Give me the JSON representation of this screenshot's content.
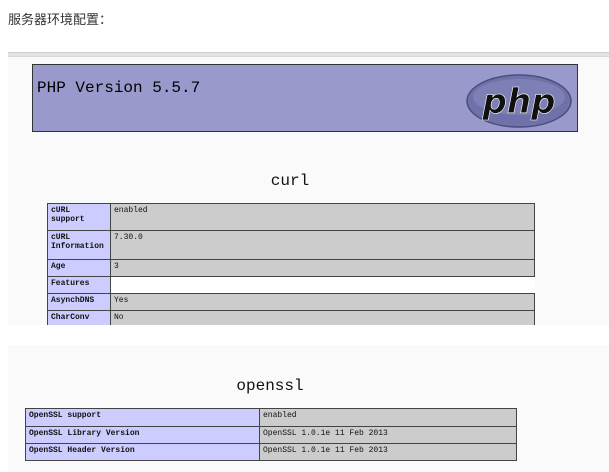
{
  "intro": "服务器环境配置：",
  "header": {
    "version": "PHP Version 5.5.7",
    "logo_text": "php"
  },
  "curl": {
    "title": "curl",
    "rows": [
      {
        "label": "cURL support",
        "value": "enabled"
      },
      {
        "label": "cURL Information",
        "value": "7.30.0"
      },
      {
        "label": "Age",
        "value": "3"
      },
      {
        "label": "Features",
        "value": ""
      },
      {
        "label": "AsynchDNS",
        "value": "Yes"
      },
      {
        "label": "CharConv",
        "value": "No"
      }
    ]
  },
  "openssl": {
    "title": "openssl",
    "rows": [
      {
        "label": "OpenSSL support",
        "value": "enabled"
      },
      {
        "label": "OpenSSL Library Version",
        "value": "OpenSSL 1.0.1e 11 Feb 2013"
      },
      {
        "label": "OpenSSL Header Version",
        "value": "OpenSSL 1.0.1e 11 Feb 2013"
      }
    ]
  },
  "colors": {
    "header_bg": "#9999cc",
    "label_bg": "#ccccff",
    "value_bg": "#cccccc"
  }
}
